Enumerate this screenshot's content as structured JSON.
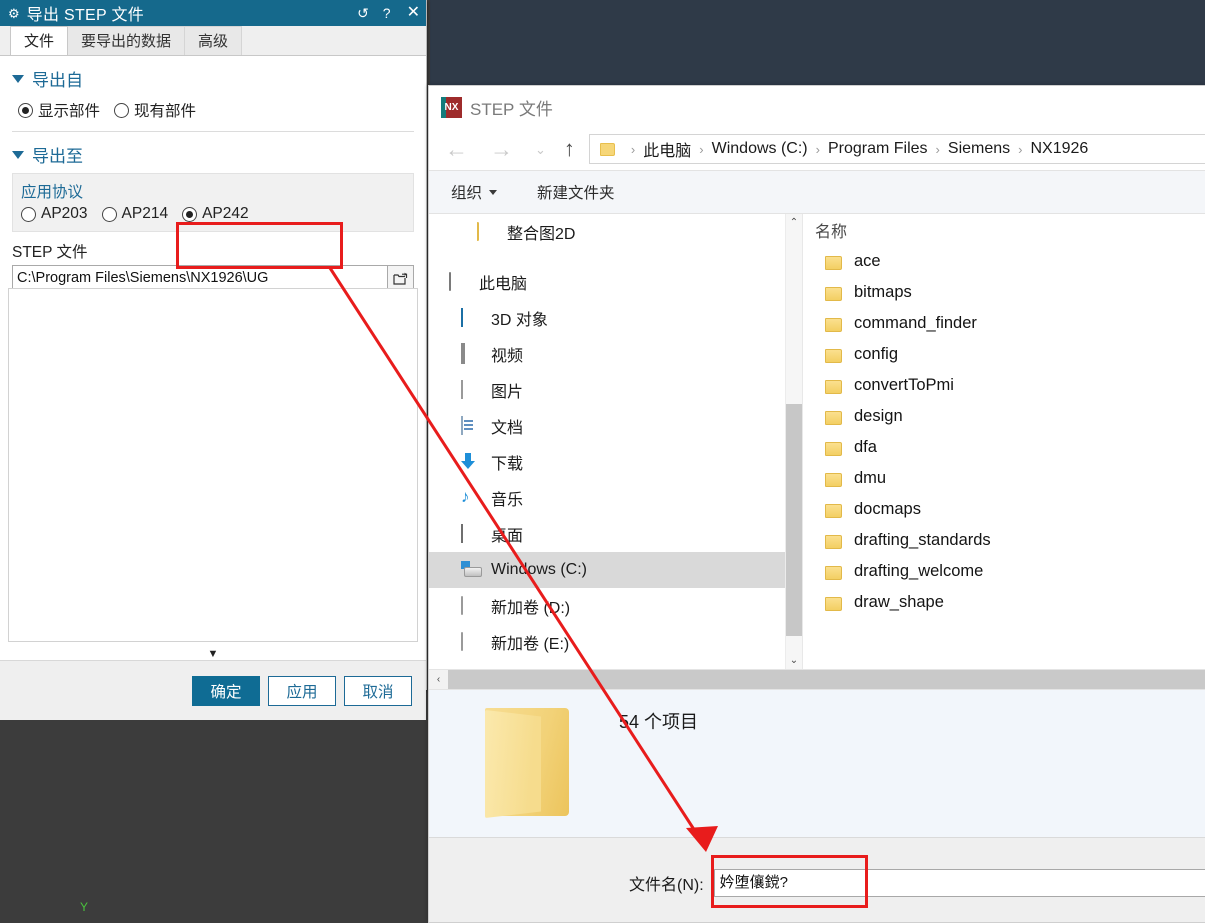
{
  "nx_dialog": {
    "title": "导出 STEP 文件",
    "title_icons": {
      "gear": "gear-icon",
      "reset": "↺",
      "help": "?",
      "close": "✕"
    },
    "tabs": [
      {
        "label": "文件",
        "active": true
      },
      {
        "label": "要导出的数据",
        "active": false
      },
      {
        "label": "高级",
        "active": false
      }
    ],
    "export_from": {
      "header": "导出自",
      "options": [
        {
          "label": "显示部件",
          "checked": true
        },
        {
          "label": "现有部件",
          "checked": false
        }
      ]
    },
    "export_to": {
      "header": "导出至",
      "group_label": "应用协议",
      "protocols": [
        {
          "label": "AP203",
          "checked": false
        },
        {
          "label": "AP214",
          "checked": false
        },
        {
          "label": "AP242",
          "checked": true
        }
      ],
      "file_field_label": "STEP 文件",
      "file_path": "C:\\Program Files\\Siemens\\NX1926\\UG",
      "browse_icon": "folder-open-icon"
    },
    "more_arrow": "▼",
    "buttons": [
      {
        "label": "确定",
        "primary": true
      },
      {
        "label": "应用",
        "primary": false
      },
      {
        "label": "取消",
        "primary": false
      }
    ]
  },
  "explorer": {
    "title": "STEP 文件",
    "logo_text": "NX",
    "nav": {
      "back": "←",
      "forward": "→",
      "recent": "⌄",
      "up": "↑"
    },
    "breadcrumb": {
      "folder_icon": "folder-icon",
      "items": [
        "此电脑",
        "Windows (C:)",
        "Program Files",
        "Siemens",
        "NX1926"
      ],
      "separator": "›"
    },
    "toolbar": [
      {
        "label": "组织",
        "has_caret": true
      },
      {
        "label": "新建文件夹",
        "has_caret": false
      }
    ],
    "tree": [
      {
        "label": "整合图2D",
        "icon": "folder-icon",
        "indent": 2,
        "selected": false
      },
      {
        "label": "",
        "icon": "spacer",
        "indent": 0,
        "selected": false,
        "spacer": true
      },
      {
        "label": "此电脑",
        "icon": "this-pc-icon",
        "indent": 0,
        "selected": false
      },
      {
        "label": "3D 对象",
        "icon": "3d-objects-icon",
        "indent": 1,
        "selected": false
      },
      {
        "label": "视频",
        "icon": "videos-icon",
        "indent": 1,
        "selected": false
      },
      {
        "label": "图片",
        "icon": "pictures-icon",
        "indent": 1,
        "selected": false
      },
      {
        "label": "文档",
        "icon": "documents-icon",
        "indent": 1,
        "selected": false
      },
      {
        "label": "下载",
        "icon": "downloads-icon",
        "indent": 1,
        "selected": false
      },
      {
        "label": "音乐",
        "icon": "music-icon",
        "indent": 1,
        "selected": false
      },
      {
        "label": "桌面",
        "icon": "desktop-icon",
        "indent": 1,
        "selected": false
      },
      {
        "label": "Windows (C:)",
        "icon": "windows-drive-icon",
        "indent": 1,
        "selected": true
      },
      {
        "label": "新加卷 (D:)",
        "icon": "drive-icon",
        "indent": 1,
        "selected": false
      },
      {
        "label": "新加卷 (E:)",
        "icon": "drive-icon",
        "indent": 1,
        "selected": false
      }
    ],
    "list_header": "名称",
    "list_sort_caret": "⌃",
    "files": [
      {
        "name": "ace",
        "icon": "folder-icon"
      },
      {
        "name": "bitmaps",
        "icon": "folder-icon"
      },
      {
        "name": "command_finder",
        "icon": "folder-icon"
      },
      {
        "name": "config",
        "icon": "folder-icon"
      },
      {
        "name": "convertToPmi",
        "icon": "folder-icon"
      },
      {
        "name": "design",
        "icon": "folder-icon"
      },
      {
        "name": "dfa",
        "icon": "folder-icon"
      },
      {
        "name": "dmu",
        "icon": "folder-icon"
      },
      {
        "name": "docmaps",
        "icon": "folder-icon"
      },
      {
        "name": "drafting_standards",
        "icon": "folder-icon"
      },
      {
        "name": "drafting_welcome",
        "icon": "folder-icon"
      },
      {
        "name": "draw_shape",
        "icon": "folder-icon"
      }
    ],
    "scroll": {
      "up_arrow": "⌃",
      "down_arrow": "⌄",
      "left_arrow": "‹"
    },
    "preview": {
      "folder_icon": "large-folder-icon",
      "item_count": "54 个项目"
    },
    "footer": {
      "filename_label": "文件名(N):",
      "filename_value": "妗堕儴鎲?"
    }
  },
  "viewport": {
    "axis_label": "Y"
  },
  "annotations": {
    "accent_color": "#e81c1c"
  }
}
